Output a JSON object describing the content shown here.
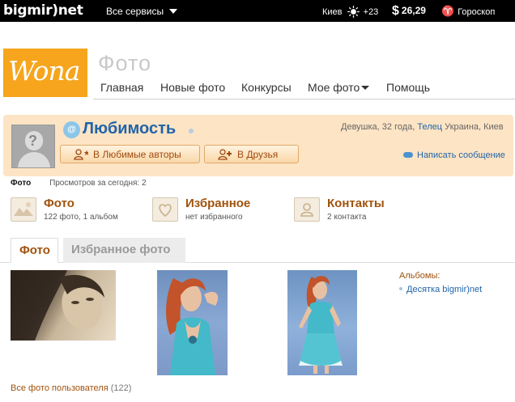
{
  "topbar": {
    "logo": "bigmir)net",
    "services": "Все сервисы",
    "city": "Киев",
    "temperature": "+23",
    "dollar_sign": "$",
    "rate": "26,29",
    "horoscope": "Гороскоп"
  },
  "header": {
    "logo_text": "Wona",
    "section_title": "Фото",
    "nav": [
      "Главная",
      "Новые фото",
      "Конкурсы",
      "Мое фото",
      "Помощь"
    ]
  },
  "profile": {
    "name": "Любимость",
    "info_prefix": "Девушка, 32 года,",
    "zodiac": "Телец",
    "info_suffix": "Украина, Киев",
    "add_favorite": "В Любимые авторы",
    "add_friend": "В Друзья",
    "send_message": "Написать сообщение"
  },
  "stats": {
    "breadcrumb": "Фото",
    "views": "Просмотров за сегодня: 2"
  },
  "sections": [
    {
      "title": "Фото",
      "subtitle": "122 фото, 1 альбом"
    },
    {
      "title": "Избранное",
      "subtitle": "нет избранного"
    },
    {
      "title": "Контакты",
      "subtitle": "2 контакта"
    }
  ],
  "tabs": [
    "Фото",
    "Избранное фото"
  ],
  "albums": {
    "heading": "Альбомы:",
    "items": [
      "Десятка bigmir)net"
    ]
  },
  "all_photos": {
    "label": "Все фото пользователя",
    "count": "(122)"
  },
  "colors": {
    "accent_orange": "#a0520c",
    "link_blue": "#2264a9",
    "profile_bg": "#fde4c4",
    "wona_orange": "#f6a51c"
  }
}
